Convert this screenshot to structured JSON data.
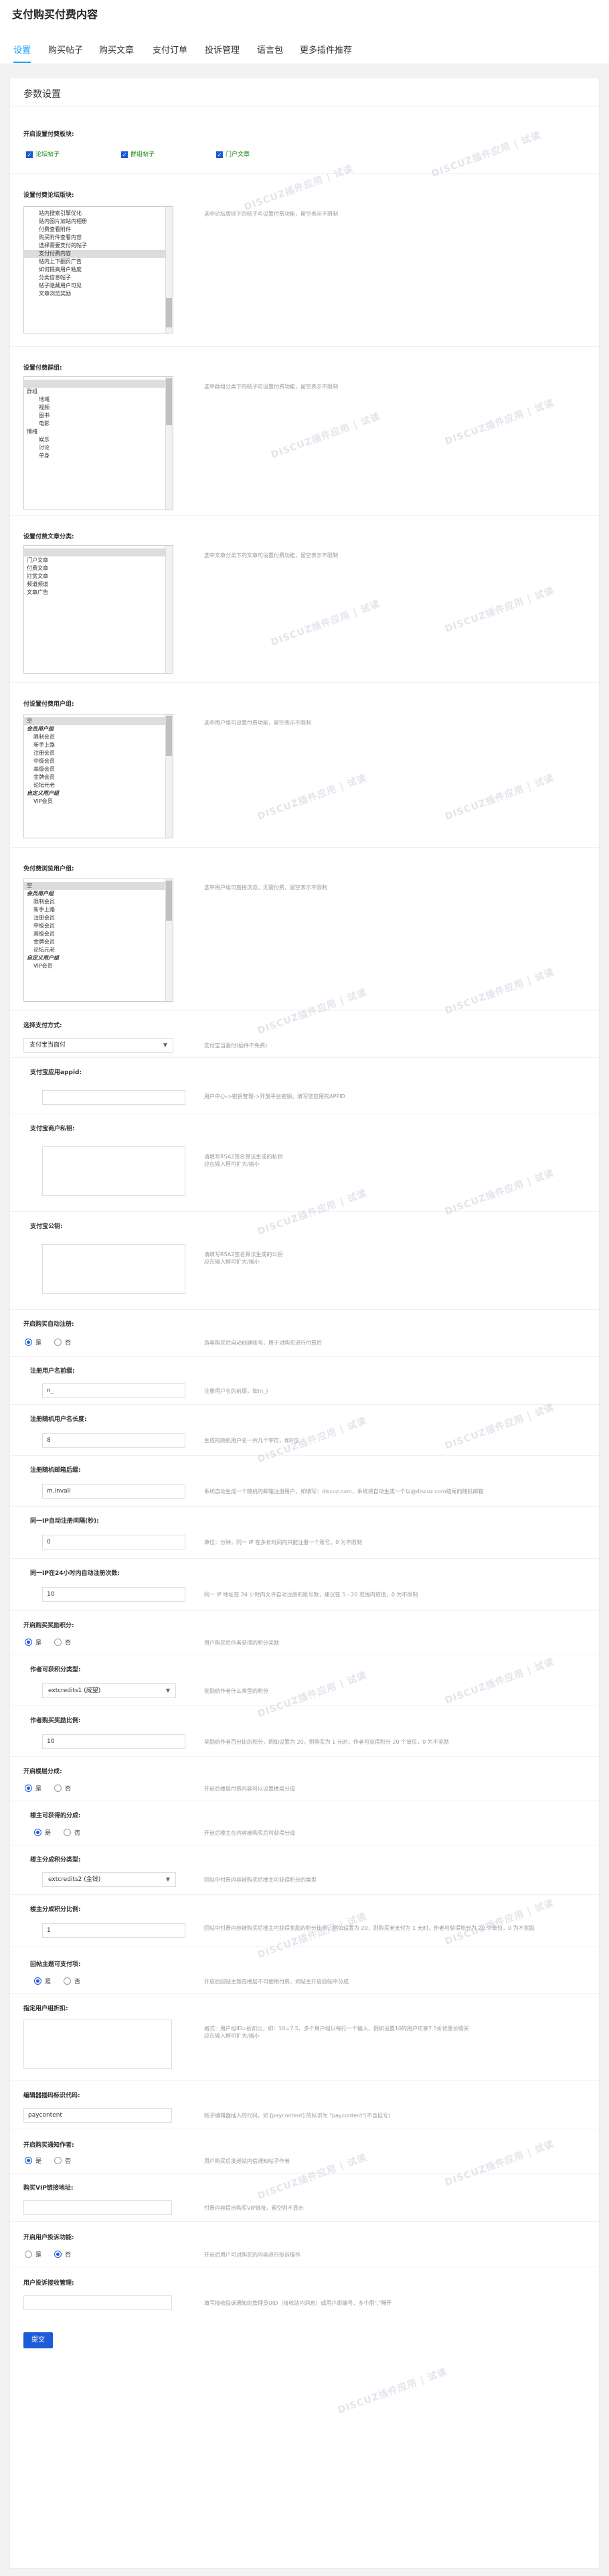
{
  "page_title": "支付购买付费内容",
  "tabs": [
    "设置",
    "购买帖子",
    "购买文章",
    "支付订单",
    "投诉管理",
    "语言包",
    "更多插件推荐"
  ],
  "card_title": "参数设置",
  "watermark": "DISCUZ插件应用 | 试读",
  "s1": {
    "label": "开启设置付费板块:",
    "options": [
      "论坛帖子",
      "群组帖子",
      "门户文章"
    ]
  },
  "s2": {
    "label": "设置付费论坛版块:",
    "hint": "选中论坛版块下的帖子可设置付费功能，留空表示不限制",
    "options": [
      "站内搜索引擎优化",
      "贴内图片加站内相册",
      "付费查看附件",
      "购买附件查看内容",
      "选择需要支付的帖子",
      "支付付费内容",
      "帖内上下翻页广告",
      "如何提高用户粘度",
      "分类信息帖子",
      "帖子隐藏用户可见",
      "文章浏览奖励"
    ]
  },
  "s3": {
    "label": "设置付费群组:",
    "hint": "选中群组分类下的帖子可设置付费功能，留空表示不限制",
    "options": [
      "",
      "群组",
      "地域",
      "视频",
      "图书",
      "电影",
      "情绪",
      "娱乐",
      "讨论",
      "单身"
    ]
  },
  "s4": {
    "label": "设置付费文章分类:",
    "hint": "选中文章分类下的文章可设置付费功能，留空表示不限制",
    "options": [
      "",
      "门户文章",
      "付费文章",
      "打赏文章",
      "频道频道",
      "文章广告"
    ]
  },
  "s5": {
    "label": "付设置付费用户组:",
    "hint": "选中用户组可设置付费功能，留空表示不限制",
    "options": [
      "空",
      "会员用户组",
      "限制会员",
      "新手上路",
      "注册会员",
      "中级会员",
      "高级会员",
      "金牌会员",
      "论坛元老",
      "自定义用户组",
      "VIP会员"
    ]
  },
  "s6": {
    "label": "免付费浏览用户组:",
    "hint": "选中用户组可直接浏览，无需付费，留空表示不限制",
    "options": [
      "空",
      "会员用户组",
      "限制会员",
      "新手上路",
      "注册会员",
      "中级会员",
      "高级会员",
      "金牌会员",
      "论坛元老",
      "自定义用户组",
      "VIP会员"
    ]
  },
  "s7": {
    "label": "选择支付方式:",
    "value": "支付宝当面付",
    "hint": "支付宝当面付(插件不免费)"
  },
  "s8": {
    "label": "支付宝应用appid:",
    "hint": "用户中心->密钥管理->开放平台密钥，填写您应用的APPID"
  },
  "s9": {
    "label": "支付宝商户私钥:",
    "hint": "请填写RSA2签名算法生成的私钥\n应在输入框可扩大/缩小"
  },
  "s10": {
    "label": "支付宝公钥:",
    "hint": "请填写RSA2签名算法生成的公钥\n应在输入框可扩大/缩小"
  },
  "s11": {
    "label": "开启购买自动注册:",
    "yes": "是",
    "no": "否",
    "hint": "游客购买后自动创建账号，用于对购买进行付费后"
  },
  "s12": {
    "label": "注册用户名前缀:",
    "value": "n_",
    "hint": "注册用户名的前缀，如(n_)"
  },
  "s13": {
    "label": "注册随机用户名长度:",
    "value": "8",
    "hint": "生成的随机用户名一共几个字符，如8位"
  },
  "s14": {
    "label": "注册随机邮箱后缀:",
    "value": "m.invali",
    "hint": "系统自动生成一个随机的邮箱注册用户，如填写：discuz.com，系统将自动生成一个以@discuz.com结尾的随机邮箱"
  },
  "s15": {
    "label": "同一IP自动注册间隔(秒):",
    "value": "0",
    "hint": "单位：分钟，同一 IP 在多长时间内只能注册一个账号，0 为不限制"
  },
  "s16": {
    "label": "同一IP在24小时内自动注册次数:",
    "value": "10",
    "hint": "同一 IP 地址在 24 小时内允许自动注册的账号数，建议在 5 - 20 范围内取值，0 为不限制"
  },
  "s17": {
    "label": "开启购买奖励积分:",
    "yes": "是",
    "no": "否",
    "hint": "用户购买后作者获得的积分奖励"
  },
  "s18": {
    "label": "作者可获积分类型:",
    "value": "extcredits1 (威望)",
    "hint": "奖励给作者什么类型的积分"
  },
  "s19": {
    "label": "作者购买奖励比例:",
    "value": "10",
    "hint": "奖励给作者百分比的积分，例如设置为 20，则购买为 1 元时，作者可获得积分 20 个单位，0 为不奖励"
  },
  "s20": {
    "label": "开启楼层分成:",
    "yes": "是",
    "no": "否",
    "hint": "开启后楼层付费内容可以设置楼层分成"
  },
  "s21": {
    "label": "楼主可获得的分成:",
    "yes": "是",
    "no": "否",
    "hint": "开启后楼主在内容被购买后可获得分成"
  },
  "s22": {
    "label": "楼主分成积分类型:",
    "value": "extcredits2 (金钱)",
    "hint": "回帖中付费内容被购买后楼主可获得积分的类型"
  },
  "s23": {
    "label": "楼主分成积分比例:",
    "value": "1",
    "hint": "回帖中付费内容被购买后楼主可获得奖励的积分比例，例如设置为 20，则购买者支付为 1 元时，作者可获得积分为 20 个单位，0 为不奖励"
  },
  "s24": {
    "label": "回帖主题可支付项:",
    "yes": "是",
    "no": "否",
    "hint": "开启后回帖主题在楼层不可使用付费，如帖主开启回帖中分成"
  },
  "s25": {
    "label": "指定用户组折扣:",
    "hint": "格式：用户组ID=折扣比，如：10=7.5，多个用户组以每行一个输入，例如设置10的用户可享7.5折优惠价购买\n应在输入框可扩大/缩小"
  },
  "s26": {
    "label": "编辑器插码标识代码:",
    "value": "paycontent",
    "hint": "帖子编辑器插入的代码，如 [paycontent] 的标识为 \"paycontent\"(不含括号)"
  },
  "s27": {
    "label": "开启购买通知作者:",
    "yes": "是",
    "no": "否",
    "hint": "用户购买后发送站内信通知帖子作者"
  },
  "s28": {
    "label": "购买VIP链接地址:",
    "hint": "付费内容提示购买VIP链接，留空则不显示"
  },
  "s29": {
    "label": "开启用户投诉功能:",
    "yes": "是",
    "no": "否",
    "hint": "开启后用户可对购买的内容进行投诉操作"
  },
  "s30": {
    "label": "用户投诉接收管理:",
    "hint": "填写接收投诉通知的管理员UID（接收站内消息）或用户组编号，多个用\",\"隔开"
  },
  "submit": "提交"
}
